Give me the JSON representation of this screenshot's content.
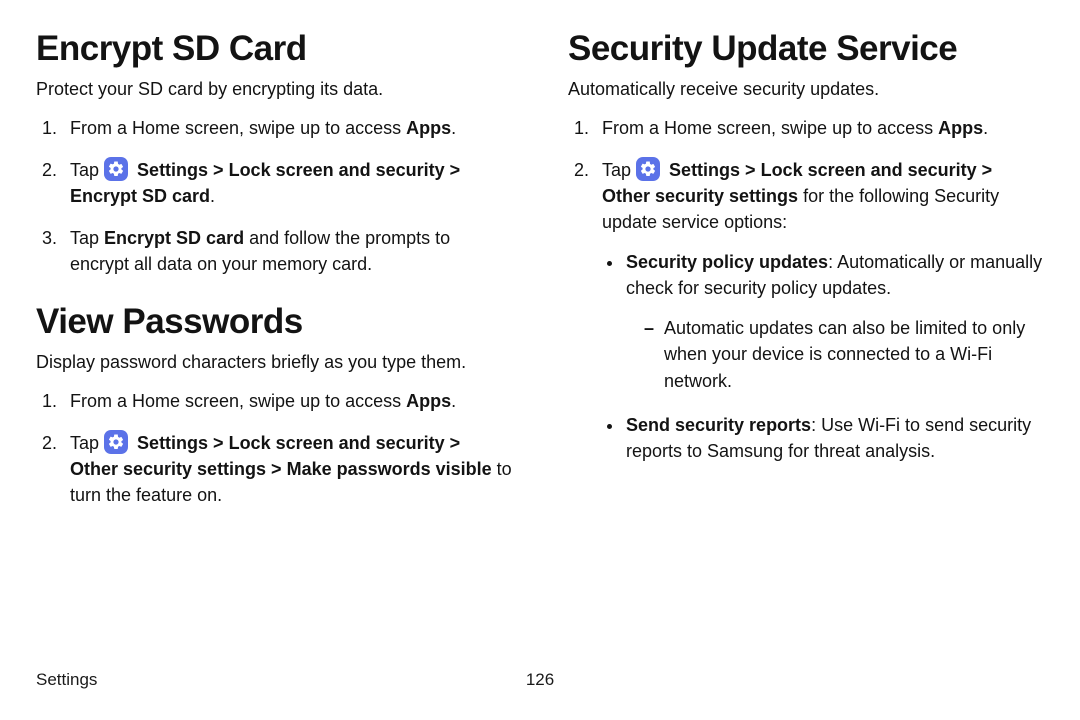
{
  "left": {
    "h1a": "Encrypt SD Card",
    "lead_a": "Protect your SD card by encrypting its data.",
    "a1_pre": "From a Home screen, swipe up to access ",
    "a1_b": "Apps",
    "a1_post": ".",
    "a2_pre": "Tap ",
    "a2_b": "Settings > Lock screen and security > Encrypt SD card",
    "a2_post": ".",
    "a3_pre": "Tap ",
    "a3_b": "Encrypt SD card",
    "a3_post": " and follow the prompts to encrypt all data on your memory card.",
    "h1b": "View Passwords",
    "lead_b": "Display password characters briefly as you type them.",
    "b1_pre": "From a Home screen, swipe up to access ",
    "b1_b": "Apps",
    "b1_post": ".",
    "b2_pre": "Tap ",
    "b2_b": "Settings > Lock screen and security > Other security settings > Make passwords visible",
    "b2_post": " to turn the feature on."
  },
  "right": {
    "h1": "Security Update Service",
    "lead": "Automatically receive security updates.",
    "r1_pre": "From a Home screen, swipe up to access ",
    "r1_b": "Apps",
    "r1_post": ".",
    "r2_pre": "Tap ",
    "r2_b": "Settings > Lock screen and security > Other security settings",
    "r2_post": " for the following Security update service options:",
    "bul1_b": "Security policy updates",
    "bul1_post": ": Automatically or manually check for security policy updates.",
    "bul1_sub": "Automatic updates can also be limited to only when your device is connected to a Wi-Fi network.",
    "bul2_b": "Send security reports",
    "bul2_post": ": Use Wi-Fi to send security reports to Samsung for threat analysis."
  },
  "footer": {
    "section": "Settings",
    "page": "126"
  }
}
